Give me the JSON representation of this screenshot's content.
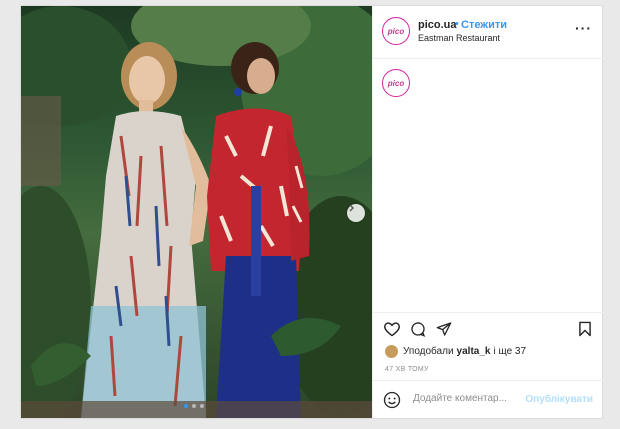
{
  "account": {
    "username": "pico.ua",
    "avatar_text": "pico",
    "separator": "•",
    "follow_label": "Стежити",
    "location": "Eastman Restaurant"
  },
  "header": {
    "more_icon": "more-horizontal-icon"
  },
  "actions": {
    "icons": [
      "heart-icon",
      "comment-icon",
      "share-icon",
      "bookmark-icon"
    ]
  },
  "likes": {
    "prefix": "Уподобали",
    "user": "yalta_k",
    "suffix": "і ще 37"
  },
  "time": "47 хв тому",
  "comment": {
    "placeholder": "Додайте коментар...",
    "publish_label": "Опублікувати"
  },
  "carousel": {
    "slides": 3,
    "active": 1
  },
  "colors": {
    "accent": "#3897f0",
    "text": "#262626",
    "muted": "#8e8e8e",
    "publish_disabled": "#b2dffc"
  }
}
